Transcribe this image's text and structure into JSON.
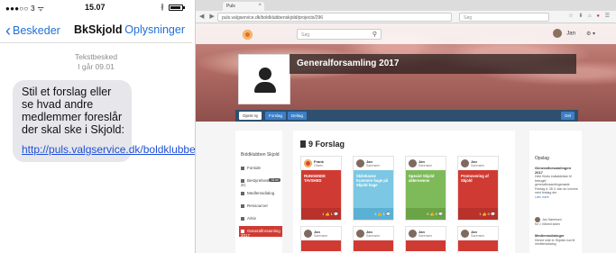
{
  "phone": {
    "carrier": "●●●○○ 3 ᯤ",
    "time": "15.07",
    "bluetooth": "∦",
    "nav": {
      "back_label": "Beskeder",
      "title": "BkSkjold",
      "info_label": "Oplysninger"
    },
    "meta_label": "Tekstbesked",
    "meta_time": "I går 09.01",
    "message": "Stil et forslag eller se hvad andre medlemmer foreslår der skal ske i Skjold:",
    "link": "http://puls.valgservice.dk/boldklubbenskjold"
  },
  "browser": {
    "tab_title": "Puls",
    "url": "puls.valgservice.dk/boldklubbenskjold/projects/296",
    "search_placeholder": "Søg",
    "traffic_colors": [
      "#ee5b52",
      "#f4bd4f",
      "#5fc453"
    ]
  },
  "site": {
    "search_placeholder": "Søg",
    "user_name": "Jan",
    "page_title": "Generalforsamling 2017",
    "actions": {
      "primary": "Opret ny",
      "b2": "Forslag",
      "b3": "Deltag",
      "right": "Del"
    },
    "sidebar": {
      "club": "Boldklubben Skjold",
      "items": [
        {
          "label": "Forside",
          "badge": ""
        },
        {
          "label": "Bestyrelsesmøde 2C",
          "badge": "33 mi"
        },
        {
          "label": "Medlemsdialog",
          "badge": ""
        },
        {
          "label": "Ressourcer",
          "badge": ""
        },
        {
          "label": "Arkiv",
          "badge": ""
        },
        {
          "label": "Generalforsamling 2017",
          "badge": ""
        }
      ]
    },
    "main_heading": "9 Forslag",
    "cards": [
      {
        "name": "Frank",
        "sub": "Ohsen",
        "text": "RUNGENDE TAVSHED",
        "footer": "1 👍 1 💬",
        "color": "red"
      },
      {
        "name": "Jan",
        "sub": "Sørensen",
        "text": "Skilehavne Kunmere hage på Skjold hage",
        "footer": "1 👍 1 💬",
        "color": "blue"
      },
      {
        "name": "Jan",
        "sub": "Sørensen",
        "text": "Speciel Skjold aldersemne",
        "footer": "0 👍 0 💬",
        "color": "green"
      },
      {
        "name": "Jan",
        "sub": "Sørensen",
        "text": "Promovering af Skjold",
        "footer": "1 👍 0 💬",
        "color": "red"
      },
      {
        "name": "Jan",
        "sub": "Sørensen",
        "text": "",
        "footer": "",
        "color": "red"
      },
      {
        "name": "Jan",
        "sub": "Sørensen",
        "text": "",
        "footer": "",
        "color": "red"
      },
      {
        "name": "Jan",
        "sub": "Sørensen",
        "text": "",
        "footer": "",
        "color": "red"
      },
      {
        "name": "Jan",
        "sub": "Sørensen",
        "text": "",
        "footer": "",
        "color": "red"
      }
    ],
    "rightbar": {
      "heading": "Opslag",
      "post1_title": "Generalforsamlingen 2017",
      "post1_text": "Hele Klubs indkaldelsen til bekuget generalforsamlingsmøde Fredag d. 28.3. kan du komme med forslag der",
      "read_more": "Læs mere",
      "author": "Jan Sørensen",
      "author_sub": "for 1 måned siden",
      "post2_title": "Medlemsdialoger",
      "post2_text": "Denne side er Skjolds kud til medlemsdialog"
    }
  }
}
